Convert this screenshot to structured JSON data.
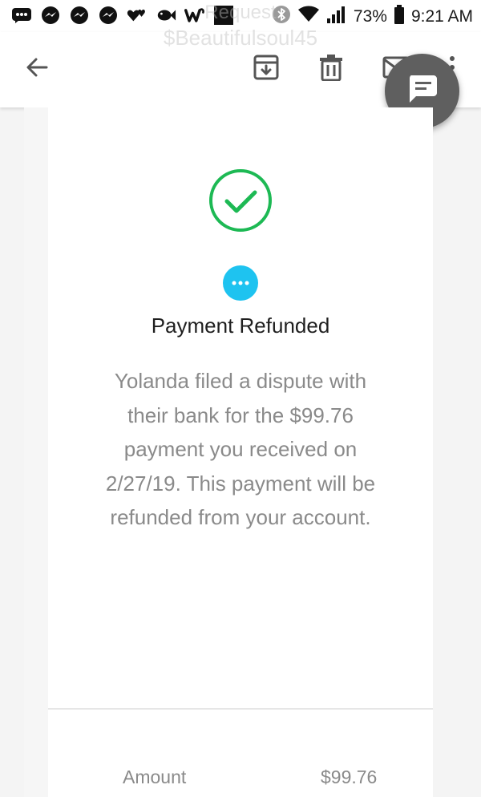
{
  "status_bar": {
    "battery": "73%",
    "time": "9:21 AM"
  },
  "ghost_header": {
    "line1": "Request",
    "line2": "$Beautifulsoul45"
  },
  "toolbar": {
    "back_icon": "arrow-left",
    "archive_icon": "archive-download",
    "delete_icon": "trash",
    "mail_icon": "mail",
    "more_icon": "more-vert",
    "chat_icon": "chat-bubble"
  },
  "receipt": {
    "title": "Payment Refunded",
    "message": "Yolanda filed a dispute with their bank for the $99.76 payment you received on 2/27/19. This payment will be refunded from your account.",
    "amount_label": "Amount",
    "amount_value": "$99.76"
  },
  "colors": {
    "accent_green": "#1db954",
    "info_blue": "#1ec3f0",
    "fab_gray": "#5f5f5f",
    "text_gray": "#8a8a8a"
  }
}
